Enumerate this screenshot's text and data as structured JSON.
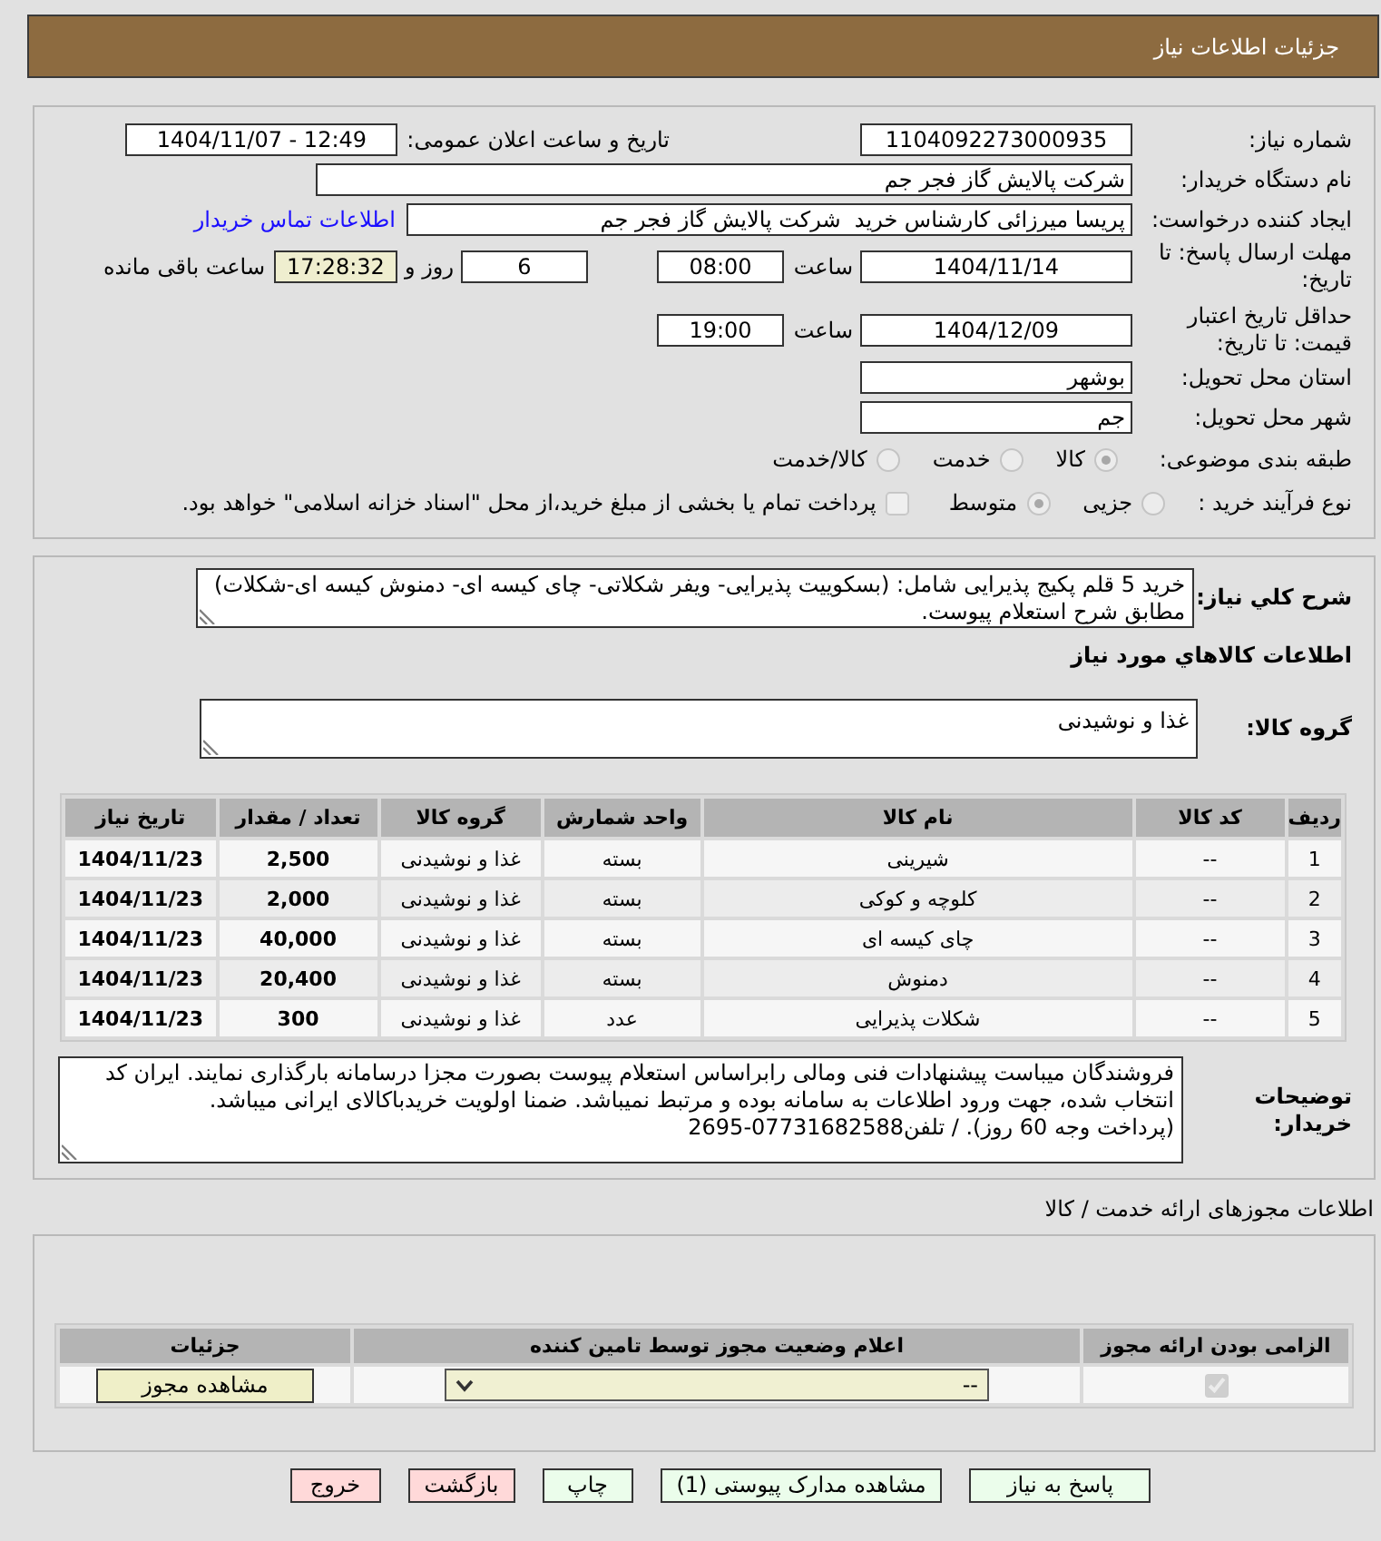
{
  "header": {
    "title": "جزئیات اطلاعات نیاز"
  },
  "details": {
    "need_number": {
      "label": "شماره نیاز:",
      "value": "1104092273000935"
    },
    "announce": {
      "label": "تاریخ و ساعت اعلان عمومی:",
      "value": "1404/11/07 - 12:49"
    },
    "buyer_org": {
      "label": "نام دستگاه خریدار:",
      "value": "شرکت پالایش گاز فجر جم"
    },
    "requester": {
      "label": "ایجاد کننده درخواست:",
      "value": "پریسا میرزائی کارشناس خرید  شرکت پالایش گاز فجر جم",
      "link": "اطلاعات تماس خریدار"
    },
    "reply_deadline": {
      "label": "مهلت ارسال پاسخ: تا تاریخ:",
      "date": "1404/11/14",
      "time_label": "ساعت",
      "time": "08:00",
      "days": "6",
      "days_label": "روز و",
      "remaining": "17:28:32",
      "remaining_label": "ساعت باقی مانده"
    },
    "price_validity": {
      "label": "حداقل تاریخ اعتبار قیمت: تا تاریخ:",
      "date": "1404/12/09",
      "time_label": "ساعت",
      "time": "19:00"
    },
    "province": {
      "label": "استان محل تحویل:",
      "value": "بوشهر"
    },
    "city": {
      "label": "شهر محل تحویل:",
      "value": "جم"
    },
    "category": {
      "label": "طبقه بندی موضوعی:",
      "options": [
        {
          "label": "کالا",
          "selected": true,
          "disabled": true
        },
        {
          "label": "خدمت",
          "selected": false,
          "disabled": true
        },
        {
          "label": "کالا/خدمت",
          "selected": false,
          "disabled": true
        }
      ]
    },
    "process": {
      "label": "نوع فرآیند خرید :",
      "options": [
        {
          "label": "جزیی",
          "selected": false,
          "disabled": true
        },
        {
          "label": "متوسط",
          "selected": true,
          "disabled": true
        }
      ],
      "treasury": {
        "label": "پرداخت تمام یا بخشی از مبلغ خرید،از محل \"اسناد خزانه اسلامی\" خواهد بود.",
        "checked": false,
        "disabled": true
      }
    }
  },
  "need": {
    "description": {
      "label": "شرح كلي نياز:",
      "value": "خرید 5 قلم پکیج پذیرایی شامل: (بسکوییت پذیرایی- ویفر شکلاتی- چای کیسه ای- دمنوش کیسه ای-شکلات) مطابق شرح استعلام پیوست."
    },
    "goods_title": "اطلاعات كالاهاي مورد نياز",
    "goods_group": {
      "label": "گروه کالا:",
      "value": "غذا و نوشیدنی"
    },
    "table": {
      "columns": [
        {
          "label": "ردیف",
          "kind": "text"
        },
        {
          "label": "کد کالا",
          "kind": "text"
        },
        {
          "label": "نام کالا",
          "kind": "text"
        },
        {
          "label": "واحد شمارش",
          "kind": "text"
        },
        {
          "label": "گروه کالا",
          "kind": "text"
        },
        {
          "label": "تعداد / مقدار",
          "kind": "number"
        },
        {
          "label": "تاریخ نیاز",
          "kind": "number"
        }
      ],
      "rows": [
        [
          "1",
          "--",
          "شیرینی",
          "بسته",
          "غذا و نوشیدنی",
          "2,500",
          "1404/11/23"
        ],
        [
          "2",
          "--",
          "کلوچه و کوکی",
          "بسته",
          "غذا و نوشیدنی",
          "2,000",
          "1404/11/23"
        ],
        [
          "3",
          "--",
          "چای کیسه ای",
          "بسته",
          "غذا و نوشیدنی",
          "40,000",
          "1404/11/23"
        ],
        [
          "4",
          "--",
          "دمنوش",
          "بسته",
          "غذا و نوشیدنی",
          "20,400",
          "1404/11/23"
        ],
        [
          "5",
          "--",
          "شکلات پذیرایی",
          "عدد",
          "غذا و نوشیدنی",
          "300",
          "1404/11/23"
        ]
      ]
    },
    "buyer_notes": {
      "label": "توضیحات خریدار:",
      "value": "فروشندگان میباست پیشنهادات فنی ومالی رابراساس استعلام پیوست بصورت مجزا درسامانه بارگذاری نمایند. ایران کد انتخاب شده، جهت ورود اطلاعات به سامانه بوده و مرتبط نمیباشد. ضمنا اولویت خریدباکالای ایرانی میباشد.\n(پرداخت وجه 60 روز). / تلفن07731682588-2695"
    }
  },
  "licenses": {
    "title": "اطلاعات مجوزهای ارائه خدمت / کالا",
    "columns": [
      "الزامی بودن ارائه مجوز",
      "اعلام وضعیت مجوز توسط تامین کننده",
      "جزئیات"
    ],
    "rows": [
      {
        "required": {
          "checked": true,
          "disabled": true
        },
        "status": "--",
        "details_button": "مشاهده مجوز"
      }
    ]
  },
  "buttons": [
    {
      "label": "پاسخ به نیاز",
      "kind": "proceed"
    },
    {
      "label": "مشاهده مدارک پیوستی (1)",
      "kind": "proceed"
    },
    {
      "label": "چاپ",
      "kind": "proceed"
    },
    {
      "label": "بازگشت",
      "kind": "leave"
    },
    {
      "label": "خروج",
      "kind": "leave"
    }
  ]
}
